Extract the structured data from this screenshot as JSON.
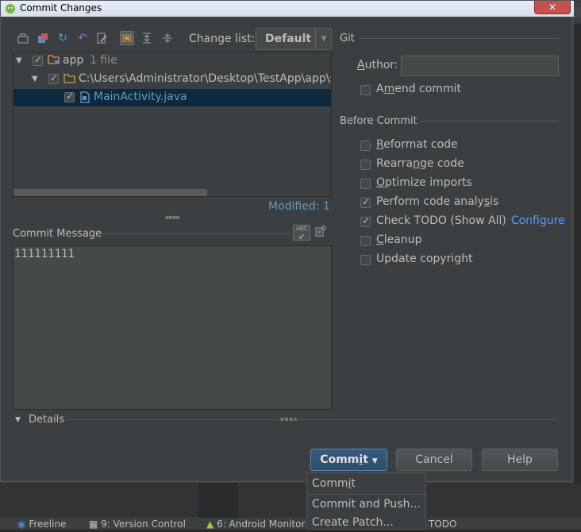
{
  "window": {
    "title": "Commit Changes",
    "close_glyph": "✕"
  },
  "toolbar": {
    "icons": [
      "diff-icon",
      "move-icon",
      "refresh-icon",
      "rollback-icon",
      "edit-source-icon",
      "group-by-directory-icon",
      "expand-all-icon",
      "collapse-all-icon"
    ],
    "changelist_label": "Change list:",
    "changelist_value": "Default"
  },
  "tree": {
    "nodes": [
      {
        "label": "app",
        "suffix": "1 file"
      },
      {
        "label": "C:\\Users\\Administrator\\Desktop\\TestApp\\app\\s"
      },
      {
        "label": "MainActivity.java"
      }
    ],
    "modified": "Modified: 1"
  },
  "commit_message": {
    "label": "Commit Message",
    "value": "111111111"
  },
  "details": {
    "label": "Details"
  },
  "git": {
    "group_label": "Git",
    "author_label": "Author:",
    "author_value": "",
    "amend_label": "Amend commit"
  },
  "before_commit": {
    "group_label": "Before Commit",
    "options": [
      {
        "label": "Reformat code",
        "checked": false
      },
      {
        "label": "Rearrange code",
        "checked": false
      },
      {
        "label": "Optimize imports",
        "checked": false
      },
      {
        "label": "Perform code analysis",
        "checked": true
      },
      {
        "label": "Check TODO (Show All)",
        "checked": true,
        "link": "Configure"
      },
      {
        "label": "Cleanup",
        "checked": false
      },
      {
        "label": "Update copyright",
        "checked": false
      }
    ]
  },
  "buttons": {
    "commit": "Commit",
    "cancel": "Cancel",
    "help": "Help"
  },
  "dropdown": {
    "items": [
      "Commit",
      "Commit and Push...",
      "Create Patch..."
    ]
  },
  "statusbar": {
    "tabs": [
      "Freeline",
      "9: Version Control",
      "6: Android Monitor",
      "TODO"
    ]
  },
  "colors": {
    "link": "#589df6",
    "modified": "#6897bb",
    "selection": "#0d293e"
  }
}
